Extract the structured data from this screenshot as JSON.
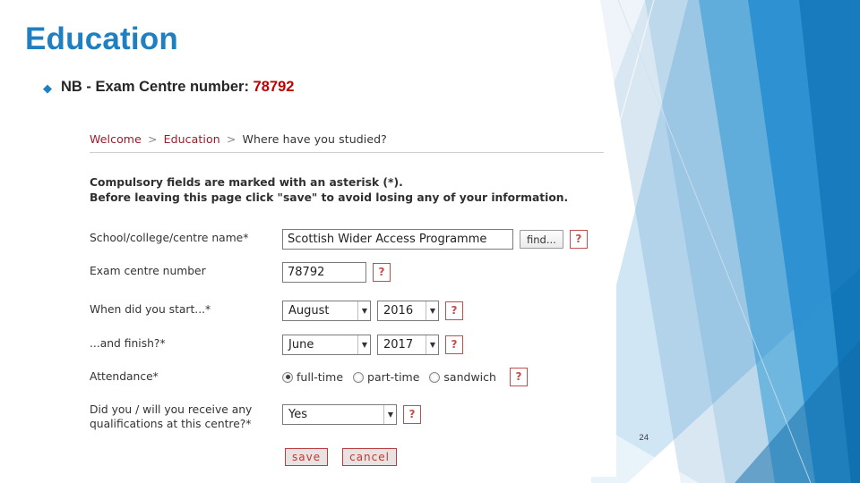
{
  "slide": {
    "title": "Education",
    "bullet": {
      "marker": "◆",
      "prefix": "NB - Exam Centre number: ",
      "highlight": "78792"
    },
    "page_number": "24",
    "accent_color": "#1f7fc0",
    "highlight_color": "#c00000"
  },
  "screenshot": {
    "breadcrumb": {
      "items": [
        "Welcome",
        "Education",
        "Where have you studied?"
      ],
      "separator": ">"
    },
    "notice_line1": "Compulsory fields are marked with an asterisk (*).",
    "notice_line2": "Before leaving this page click \"save\" to avoid losing any of your information.",
    "fields": [
      {
        "label": "School/college/centre name*",
        "value": "Scottish Wider Access Programme",
        "find_label": "find...",
        "help_label": "?"
      },
      {
        "label": "Exam centre number",
        "value": "78792",
        "help_label": "?"
      },
      {
        "label": "When did you start...*",
        "month": "August",
        "year": "2016",
        "help_label": "?"
      },
      {
        "label": "...and finish?*",
        "month": "June",
        "year": "2017",
        "help_label": "?"
      },
      {
        "label": "Attendance*",
        "options": [
          "full-time",
          "part-time",
          "sandwich"
        ],
        "selected": "full-time",
        "help_label": "?"
      },
      {
        "label": "Did you / will you receive any qualifications at this centre?*",
        "value": "Yes",
        "help_label": "?"
      }
    ],
    "buttons": {
      "save": "save",
      "cancel": "cancel"
    }
  }
}
